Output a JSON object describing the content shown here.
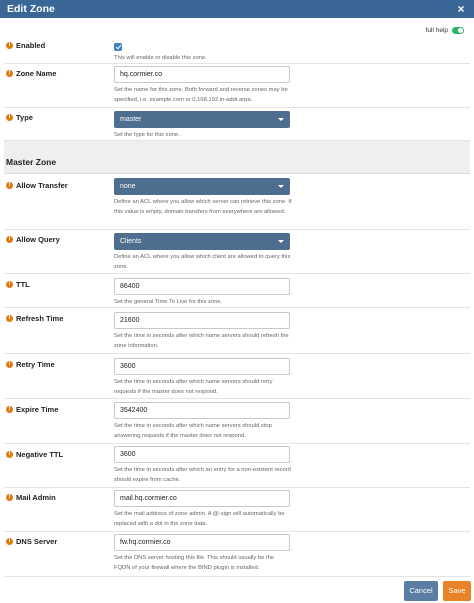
{
  "dialog": {
    "title": "Edit Zone",
    "close_glyph": "×"
  },
  "full_help": {
    "label": "full help",
    "enabled": true
  },
  "fields": {
    "enabled": {
      "label": "Enabled",
      "checked": true,
      "help": "This will enable or disable this zone."
    },
    "zone_name": {
      "label": "Zone Name",
      "value": "hq.cormier.co",
      "help": "Set the name for this zone. Both forward and reverse zones may be specified, i.e. example.com or 0.168.192.in-addr.arpa."
    },
    "type": {
      "label": "Type",
      "value": "master",
      "help": "Set the type for this zone."
    },
    "allow_transfer": {
      "label": "Allow Transfer",
      "value": "none",
      "help": "Define an ACL where you allow which server can retrieve this zone. If this value is empty, domain transfers from everywhere are allowed."
    },
    "allow_query": {
      "label": "Allow Query",
      "value": "Clients",
      "help": "Define an ACL where you allow which client are allowed to query this zone."
    },
    "ttl": {
      "label": "TTL",
      "value": "86400",
      "help": "Set the general Time To Live for this zone."
    },
    "refresh_time": {
      "label": "Refresh Time",
      "value": "21600",
      "help": "Set the time in seconds after which name servers should refresh the zone information."
    },
    "retry_time": {
      "label": "Retry Time",
      "value": "3600",
      "help": "Set the time in seconds after which name servers should retry requests if the master does not respond."
    },
    "expire_time": {
      "label": "Expire Time",
      "value": "3542400",
      "help": "Set the time in seconds after which name servers should stop answering requests if the master does not respond."
    },
    "negative_ttl": {
      "label": "Negative TTL",
      "value": "3600",
      "help": "Set the time in seconds after which an entry for a non-existent record should expire from cache."
    },
    "mail_admin": {
      "label": "Mail Admin",
      "value": "mail.hq.cormier.co",
      "help": "Set the mail address of zone admin. A @-sign will automatically be replaced with a dot in the zone data."
    },
    "dns_server": {
      "label": "DNS Server",
      "value": "fw.hq.cormier.co",
      "help": "Set the DNS server hosting this file. This should usually be the FQDN of your firewall where the BIND plugin is installed."
    }
  },
  "section": {
    "title": "Master Zone"
  },
  "info_glyph": "i",
  "buttons": {
    "cancel": "Cancel",
    "save": "Save"
  },
  "colors": {
    "header": "#3a6796",
    "select": "#4d6e8f",
    "save": "#e8832a",
    "cancel": "#5a7ea3",
    "info": "#e07a10"
  }
}
